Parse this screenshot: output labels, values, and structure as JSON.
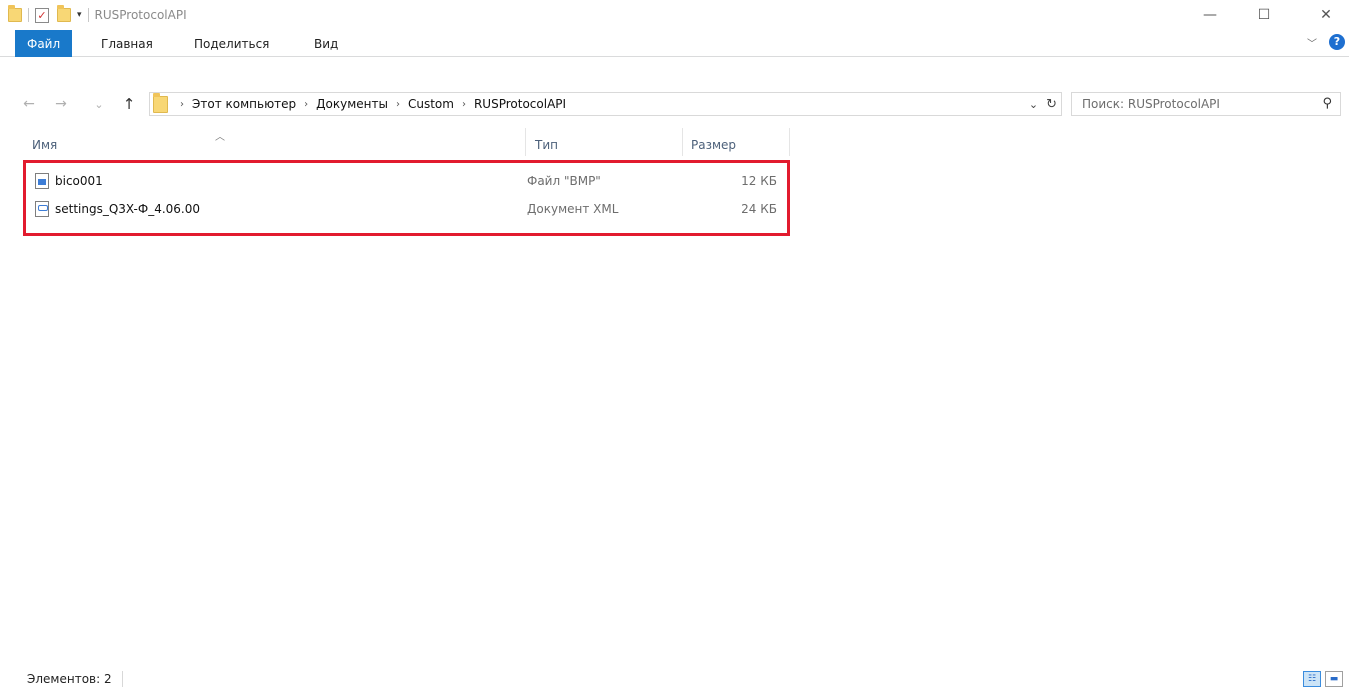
{
  "window": {
    "title": "RUSProtocolAPI",
    "quick_access_dropdown": "▾",
    "minimize": "—",
    "maximize": "☐",
    "close": "✕"
  },
  "ribbon": {
    "tabs": [
      {
        "label": "Файл"
      },
      {
        "label": "Главная"
      },
      {
        "label": "Поделиться"
      },
      {
        "label": "Вид"
      }
    ],
    "help": "?"
  },
  "nav": {
    "back": "←",
    "forward": "→",
    "recent": "⌄",
    "up": "↑",
    "breadcrumbs": [
      "Этот компьютер",
      "Документы",
      "Custom",
      "RUSProtocolAPI"
    ],
    "crumb_separator": "›",
    "search_placeholder": "Поиск: RUSProtocolAPI"
  },
  "columns": {
    "name": "Имя",
    "type": "Тип",
    "size": "Размер"
  },
  "files": [
    {
      "name": "bico001",
      "type": "Файл \"BMP\"",
      "size": "12 КБ",
      "icon": "bmp-file-icon"
    },
    {
      "name": "settings_Q3X-Ф_4.06.00",
      "type": "Документ XML",
      "size": "24 КБ",
      "icon": "xml-file-icon"
    }
  ],
  "status": {
    "items_count": "Элементов: 2"
  },
  "colors": {
    "file_tab": "#1979ca",
    "highlight": "#e21b2e",
    "header_text": "#4c607a"
  }
}
